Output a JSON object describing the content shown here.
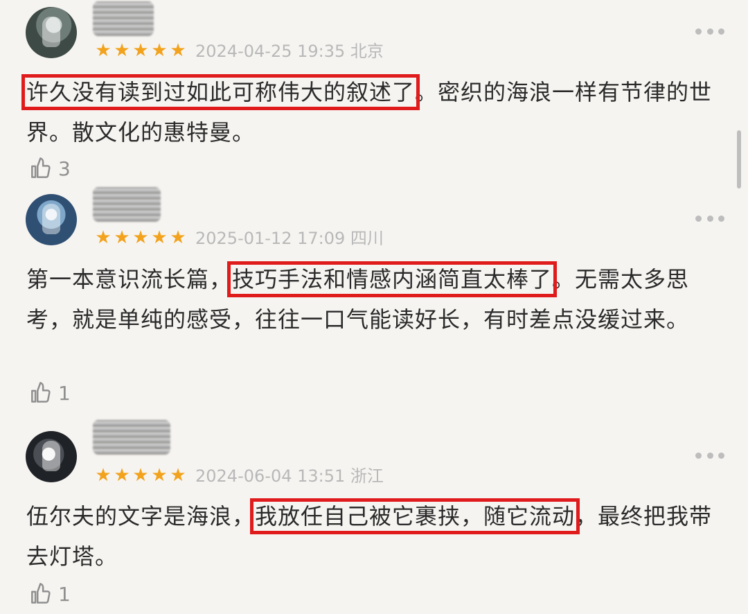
{
  "reviews": [
    {
      "avatar": "avatar-1",
      "meta": "2024-04-25 19:35 北京",
      "highlight": "许久没有读到过如此可称伟大的叙述了",
      "text_after": "。密织的海浪一样有节律的世界。散文化的惠特曼。",
      "likes": "3"
    },
    {
      "avatar": "avatar-2",
      "meta": "2025-01-12 17:09 四川",
      "text_before": "第一本意识流长篇，",
      "highlight": "技巧手法和情感内涵简直太棒了",
      "text_after": "。无需太多思考，就是单纯的感受，往往一口气能读好长，有时差点没缓过来。",
      "likes": "1"
    },
    {
      "avatar": "avatar-3",
      "meta": "2024-06-04 13:51 浙江",
      "text_before": "伍尔夫的文字是海浪，",
      "highlight": "我放任自己被它裹挟，随它流动",
      "text_after": "，最终把我带去灯塔。",
      "likes": "1"
    }
  ],
  "colors": {
    "background": "#f6f4f1",
    "star": "#f2a21c",
    "highlight_box": "#e01b1b"
  }
}
